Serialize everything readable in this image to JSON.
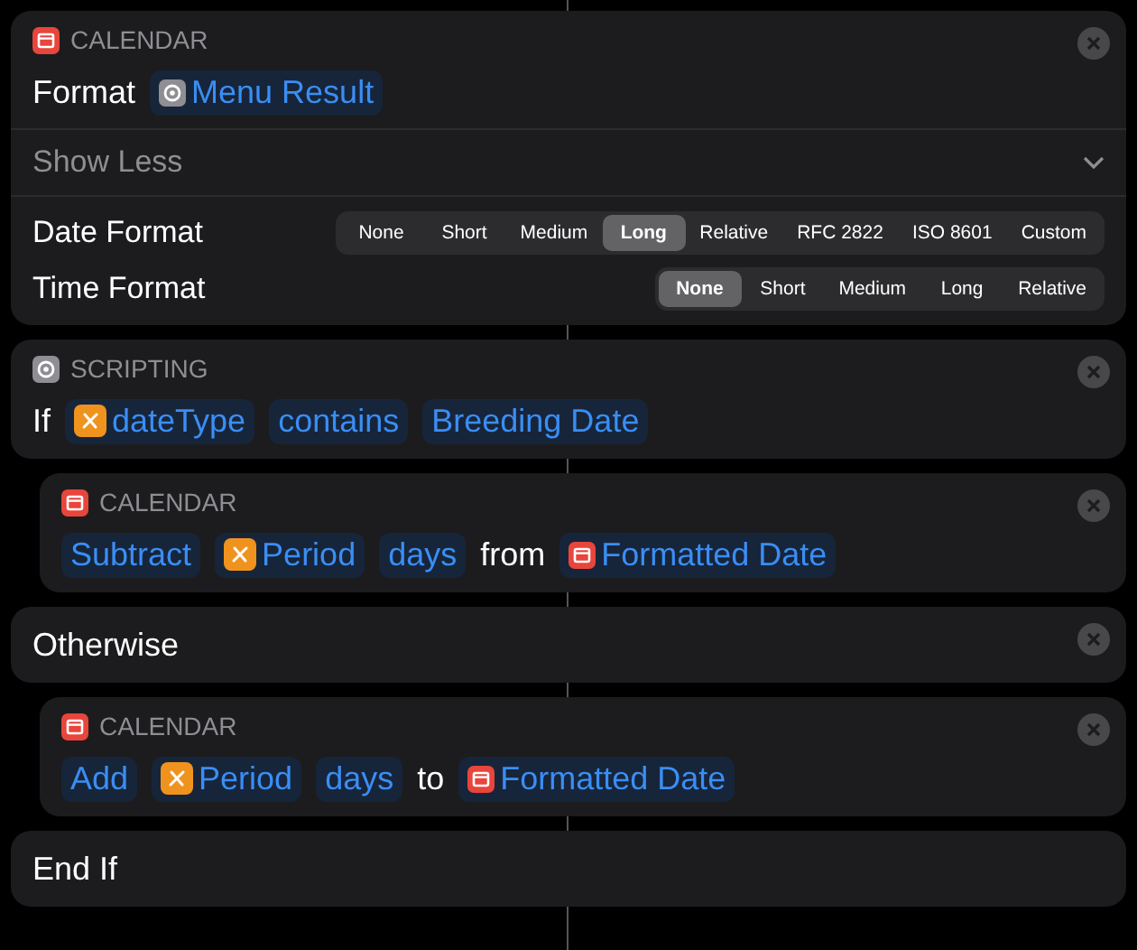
{
  "actions": [
    {
      "kind": "calendar_action",
      "nested": false,
      "closable": true,
      "app": {
        "label": "CALENDAR"
      },
      "tokens": [
        {
          "kind": "text",
          "text": "Format"
        },
        {
          "kind": "scripting_token",
          "text": "Menu Result"
        }
      ],
      "show_less": {
        "label": "Show Less",
        "expanded": true
      },
      "options": [
        {
          "label": "Date Format",
          "segments": [
            {
              "label": "None",
              "selected": false
            },
            {
              "label": "Short",
              "selected": false
            },
            {
              "label": "Medium",
              "selected": false
            },
            {
              "label": "Long",
              "selected": true
            },
            {
              "label": "Relative",
              "selected": false
            },
            {
              "label": "RFC 2822",
              "selected": false
            },
            {
              "label": "ISO 8601",
              "selected": false
            },
            {
              "label": "Custom",
              "selected": false
            }
          ]
        },
        {
          "label": "Time Format",
          "segments": [
            {
              "label": "None",
              "selected": true
            },
            {
              "label": "Short",
              "selected": false
            },
            {
              "label": "Medium",
              "selected": false
            },
            {
              "label": "Long",
              "selected": false
            },
            {
              "label": "Relative",
              "selected": false
            }
          ]
        }
      ]
    },
    {
      "kind": "scripting_action",
      "nested": false,
      "closable": true,
      "app": {
        "label": "SCRIPTING"
      },
      "tokens": [
        {
          "kind": "text",
          "text": "If"
        },
        {
          "kind": "variable_token",
          "text": "dateType"
        },
        {
          "kind": "token",
          "text": "contains"
        },
        {
          "kind": "token",
          "text": "Breeding Date"
        }
      ]
    },
    {
      "kind": "calendar_action",
      "nested": true,
      "closable": true,
      "app": {
        "label": "CALENDAR"
      },
      "tokens": [
        {
          "kind": "token",
          "text": "Subtract"
        },
        {
          "kind": "variable_token",
          "text": "Period"
        },
        {
          "kind": "token",
          "text": "days"
        },
        {
          "kind": "text",
          "text": "from"
        },
        {
          "kind": "calendar_token",
          "text": "Formatted Date"
        }
      ]
    },
    {
      "kind": "plain",
      "nested": false,
      "closable": true,
      "tokens": [
        {
          "kind": "text",
          "text": "Otherwise"
        }
      ]
    },
    {
      "kind": "calendar_action",
      "nested": true,
      "closable": true,
      "app": {
        "label": "CALENDAR"
      },
      "tokens": [
        {
          "kind": "token",
          "text": "Add"
        },
        {
          "kind": "variable_token",
          "text": "Period"
        },
        {
          "kind": "token",
          "text": "days"
        },
        {
          "kind": "text",
          "text": "to"
        },
        {
          "kind": "calendar_token",
          "text": "Formatted Date"
        }
      ]
    },
    {
      "kind": "plain",
      "nested": false,
      "closable": false,
      "tokens": [
        {
          "kind": "text",
          "text": "End If"
        }
      ]
    }
  ]
}
